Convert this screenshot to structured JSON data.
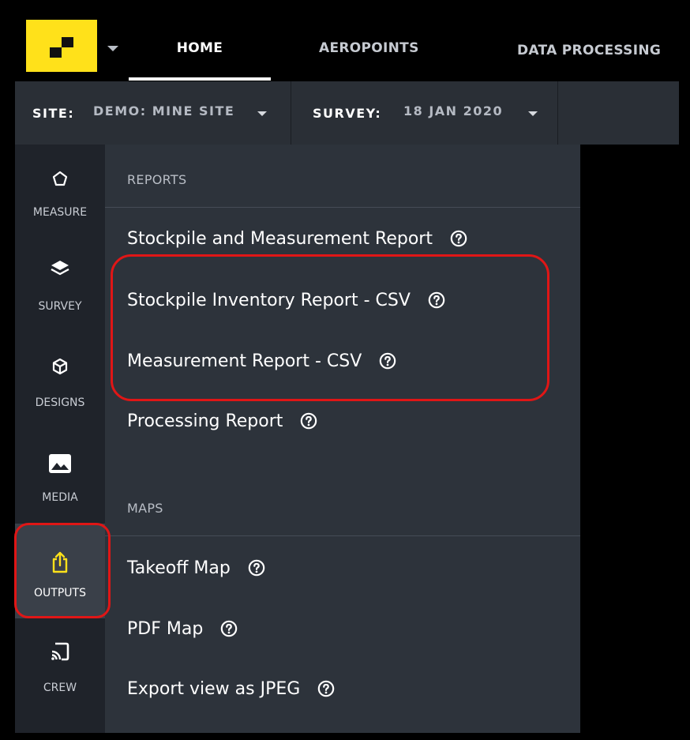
{
  "nav": {
    "tabs": [
      {
        "label": "HOME",
        "active": true
      },
      {
        "label": "AEROPOINTS",
        "active": false
      },
      {
        "label": "DATA PROCESSING",
        "active": false
      }
    ]
  },
  "context_bar": {
    "site_label": "SITE:",
    "site_value": "DEMO: MINE SITE",
    "survey_label": "SURVEY:",
    "survey_value": "18 JAN 2020"
  },
  "sidebar": {
    "items": [
      {
        "label": "MEASURE",
        "icon": "pentagon-icon"
      },
      {
        "label": "SURVEY",
        "icon": "layers-icon"
      },
      {
        "label": "DESIGNS",
        "icon": "cube-icon"
      },
      {
        "label": "MEDIA",
        "icon": "image-icon"
      },
      {
        "label": "OUTPUTS",
        "icon": "share-icon",
        "active": true
      },
      {
        "label": "CREW",
        "icon": "cast-icon"
      }
    ]
  },
  "menu": {
    "reports_heading": "REPORTS",
    "reports": [
      "Stockpile and Measurement Report",
      "Stockpile Inventory Report - CSV",
      "Measurement Report - CSV",
      "Processing Report"
    ],
    "maps_heading": "MAPS",
    "maps": [
      "Takeoff Map",
      "PDF Map",
      "Export view as JPEG"
    ]
  },
  "colors": {
    "brand_yellow": "#ffe11a",
    "highlight_red": "#e01616",
    "panel_bg": "#2d333b",
    "sidebar_bg": "#1f232a"
  }
}
